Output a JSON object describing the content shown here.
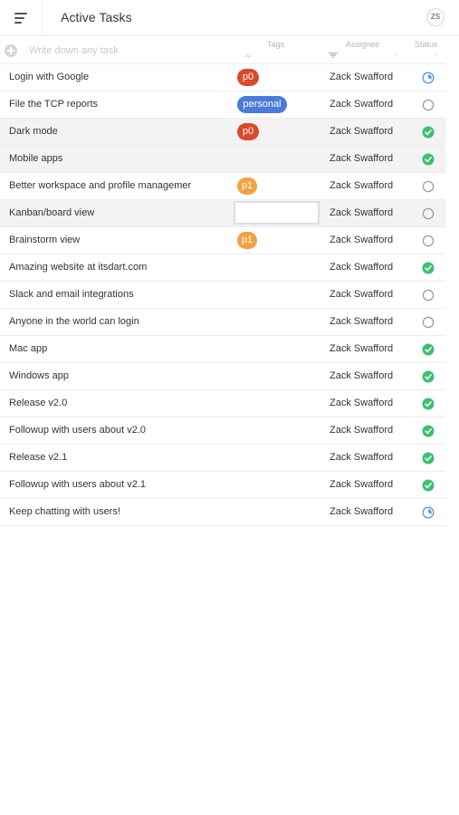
{
  "header": {
    "title": "Active Tasks",
    "avatar_initials": "ZS"
  },
  "new_task": {
    "placeholder": "Write down any task"
  },
  "columns": {
    "tags": "Tags",
    "assignee": "Assignee",
    "status": "Status"
  },
  "colors": {
    "tag_p0": "#d94a2b",
    "tag_p1": "#f0a441",
    "tag_personal": "#4a7bd9",
    "status_done": "#3fbf6f",
    "status_in_progress": "#5b9bea",
    "status_todo": "#9a9a9a"
  },
  "tasks": [
    {
      "name": "Login with Google",
      "tag": "p0",
      "assignee": "Zack Swafford",
      "status": "in-progress"
    },
    {
      "name": "File the TCP reports",
      "tag": "personal",
      "assignee": "Zack Swafford",
      "status": "todo"
    },
    {
      "name": "Dark mode",
      "tag": "p0",
      "assignee": "Zack Swafford",
      "status": "done"
    },
    {
      "name": "Mobile apps",
      "tag": "",
      "assignee": "Zack Swafford",
      "status": "done"
    },
    {
      "name": "Better workspace and profile managemer",
      "tag": "p1",
      "assignee": "Zack Swafford",
      "status": "todo"
    },
    {
      "name": "Kanban/board view",
      "tag": "",
      "assignee": "Zack Swafford",
      "status": "todo"
    },
    {
      "name": "Brainstorm view",
      "tag": "p1",
      "assignee": "Zack Swafford",
      "status": "todo"
    },
    {
      "name": "Amazing website at itsdart.com",
      "tag": "",
      "assignee": "Zack Swafford",
      "status": "done"
    },
    {
      "name": "Slack and email integrations",
      "tag": "",
      "assignee": "Zack Swafford",
      "status": "todo"
    },
    {
      "name": "Anyone in the world can login",
      "tag": "",
      "assignee": "Zack Swafford",
      "status": "todo"
    },
    {
      "name": "Mac app",
      "tag": "",
      "assignee": "Zack Swafford",
      "status": "done"
    },
    {
      "name": "Windows app",
      "tag": "",
      "assignee": "Zack Swafford",
      "status": "done"
    },
    {
      "name": "Release v2.0",
      "tag": "",
      "assignee": "Zack Swafford",
      "status": "done"
    },
    {
      "name": "Followup with users about v2.0",
      "tag": "",
      "assignee": "Zack Swafford",
      "status": "done"
    },
    {
      "name": "Release v2.1",
      "tag": "",
      "assignee": "Zack Swafford",
      "status": "done"
    },
    {
      "name": "Followup with users about v2.1",
      "tag": "",
      "assignee": "Zack Swafford",
      "status": "done"
    },
    {
      "name": "Keep chatting with users!",
      "tag": "",
      "assignee": "Zack Swafford",
      "status": "in-progress"
    }
  ]
}
